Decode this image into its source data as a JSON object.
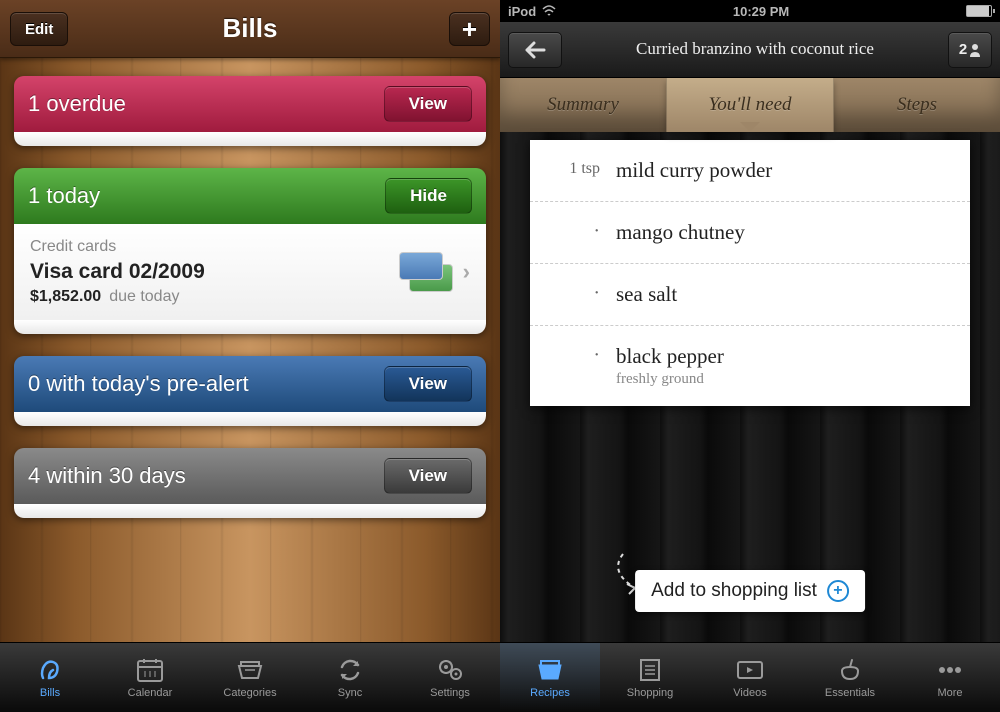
{
  "left": {
    "nav": {
      "title": "Bills",
      "edit": "Edit",
      "add": "+"
    },
    "cards": {
      "overdue": {
        "label": "1 overdue",
        "action": "View"
      },
      "today": {
        "label": "1 today",
        "action": "Hide"
      },
      "prealert": {
        "label": "0 with today's pre-alert",
        "action": "View"
      },
      "within30": {
        "label": "4 within 30 days",
        "action": "View"
      }
    },
    "detail": {
      "category": "Credit cards",
      "title": "Visa card 02/2009",
      "amount": "$1,852.00",
      "due": "due today"
    },
    "tabs": {
      "bills": "Bills",
      "calendar": "Calendar",
      "categories": "Categories",
      "sync": "Sync",
      "settings": "Settings"
    }
  },
  "right": {
    "status": {
      "carrier": "iPod",
      "time": "10:29 PM"
    },
    "nav": {
      "title": "Curried branzino with coconut rice",
      "servings": "2"
    },
    "tabs": {
      "summary": "Summary",
      "need": "You'll need",
      "steps": "Steps"
    },
    "ingredients": [
      {
        "qty": "1 tsp",
        "name": "mild curry powder",
        "note": ""
      },
      {
        "qty": "·",
        "name": "mango chutney",
        "note": ""
      },
      {
        "qty": "·",
        "name": "sea salt",
        "note": ""
      },
      {
        "qty": "·",
        "name": "black pepper",
        "note": "freshly ground"
      }
    ],
    "addShopping": "Add to shopping list",
    "btabs": {
      "recipes": "Recipes",
      "shopping": "Shopping",
      "videos": "Videos",
      "essentials": "Essentials",
      "more": "More"
    }
  }
}
